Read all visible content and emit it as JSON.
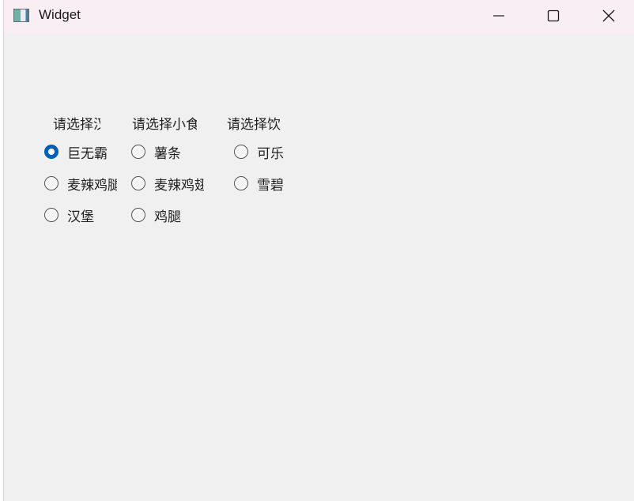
{
  "window": {
    "title": "Widget",
    "controls": {
      "minimize_icon": "minimize-icon",
      "maximize_icon": "maximize-icon",
      "close_icon": "close-icon"
    }
  },
  "groups": [
    {
      "label": "请选择汉",
      "options": [
        {
          "label": "巨无霸",
          "checked": true
        },
        {
          "label": "麦辣鸡腿",
          "checked": false
        },
        {
          "label": "汉堡",
          "checked": false
        }
      ]
    },
    {
      "label": "请选择小食",
      "options": [
        {
          "label": "薯条",
          "checked": false
        },
        {
          "label": "麦辣鸡翅",
          "checked": false
        },
        {
          "label": "鸡腿",
          "checked": false
        }
      ]
    },
    {
      "label": "请选择饮",
      "options": [
        {
          "label": "可乐",
          "checked": false
        },
        {
          "label": "雪碧",
          "checked": false
        }
      ]
    }
  ],
  "colors": {
    "accent": "#005fb8",
    "titlebar": "#f9eef4",
    "client_bg": "#f0f0f0"
  }
}
